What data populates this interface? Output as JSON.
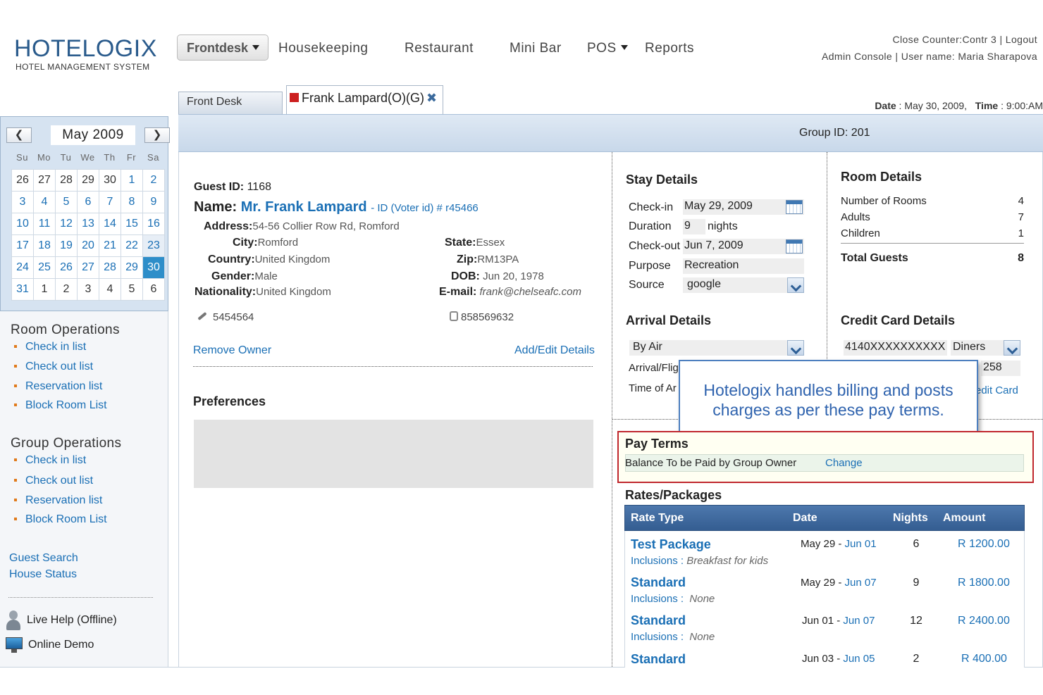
{
  "brand": {
    "name": "HOTELOGIX",
    "tagline": "HOTEL MANAGEMENT SYSTEM"
  },
  "nav": {
    "active": "Frontdesk",
    "items": [
      "Housekeeping",
      "Restaurant",
      "Mini Bar",
      "POS",
      "Reports"
    ]
  },
  "top_links": {
    "line1": "Close Counter:Contr 3 | Logout",
    "line2": "Admin Console | User name: Maria Sharapova"
  },
  "tabs": {
    "front_desk": "Front Desk",
    "guest": "Frank Lampard(O)(G)",
    "close": "✖"
  },
  "datetime": {
    "date_label": "Date",
    "date": "May 30, 2009,",
    "time_label": "Time",
    "time": "9:00:AM"
  },
  "group": {
    "text": "Group ID: 201"
  },
  "calendar": {
    "month": "May 2009",
    "prev": "❮",
    "next": "❯",
    "dow": [
      "Su",
      "Mo",
      "Tu",
      "We",
      "Th",
      "Fr",
      "Sa"
    ],
    "weeks": [
      [
        "26",
        "27",
        "28",
        "29",
        "30",
        "1",
        "2"
      ],
      [
        "3",
        "4",
        "5",
        "6",
        "7",
        "8",
        "9"
      ],
      [
        "10",
        "11",
        "12",
        "13",
        "14",
        "15",
        "16"
      ],
      [
        "17",
        "18",
        "19",
        "20",
        "21",
        "22",
        "23"
      ],
      [
        "24",
        "25",
        "26",
        "27",
        "28",
        "29",
        "30"
      ],
      [
        "31",
        "1",
        "2",
        "3",
        "4",
        "5",
        "6"
      ]
    ]
  },
  "sidebar": {
    "room_ops": {
      "title": "Room Operations",
      "items": [
        "Check in list",
        "Check out list",
        "Reservation list",
        "Block Room List"
      ]
    },
    "group_ops": {
      "title": "Group Operations",
      "items": [
        "Check in list",
        "Check out list",
        "Reservation list",
        "Block Room List"
      ]
    },
    "links": [
      "Guest Search",
      "House Status"
    ],
    "live_help": "Live Help (Offline)",
    "online_demo": "Online Demo"
  },
  "guest": {
    "id_label": "Guest ID:",
    "id": "1168",
    "name_label": "Name:",
    "name": "Mr. Frank Lampard",
    "voter": "- ID (Voter id) # r45466",
    "address_label": "Address:",
    "address": "54-56 Collier Row Rd, Romford",
    "city_label": "City:",
    "city": "Romford",
    "country_label": "Country:",
    "country": "United Kingdom",
    "gender_label": "Gender:",
    "gender": "Male",
    "nationality_label": "Nationality:",
    "nationality": "United Kingdom",
    "state_label": "State:",
    "state": "Essex",
    "zip_label": "Zip:",
    "zip": "RM13PA",
    "dob_label": "DOB:",
    "dob": "Jun 20, 1978",
    "email_label": "E-mail:",
    "email": "frank@chelseafc.com",
    "phone": "5454564",
    "mobile": "858569632",
    "remove_owner": "Remove Owner",
    "add_edit": "Add/Edit Details",
    "preferences": "Preferences"
  },
  "stay": {
    "title": "Stay Details",
    "checkin_label": "Check-in",
    "checkin": "May 29, 2009",
    "duration_label": "Duration",
    "duration": "9",
    "nights_label": "nights",
    "checkout_label": "Check-out",
    "checkout": "Jun 7, 2009",
    "purpose_label": "Purpose",
    "purpose": "Recreation",
    "source_label": "Source",
    "source": "google"
  },
  "arrival": {
    "title": "Arrival Details",
    "mode": "By Air",
    "flight_label": "Arrival/Flig",
    "time_label": "Time of Ar"
  },
  "room": {
    "title": "Room Details",
    "rooms_label": "Number of Rooms",
    "rooms": "4",
    "adults_label": "Adults",
    "adults": "7",
    "children_label": "Children",
    "children": "1",
    "total_label": "Total Guests",
    "total": "8"
  },
  "credit_card": {
    "title": "Credit Card Details",
    "number": "4140XXXXXXXXXX",
    "type": "Diners",
    "cvv": "258",
    "edit": "edit Card"
  },
  "tooltip": {
    "line1": "Hotelogix handles billing and posts",
    "line2": "charges as per these pay terms."
  },
  "pay_terms": {
    "title": "Pay Terms",
    "text": "Balance To be Paid by Group Owner",
    "change": "Change"
  },
  "rates": {
    "title": "Rates/Packages",
    "headers": {
      "type": "Rate Type",
      "date": "Date",
      "nights": "Nights",
      "amount": "Amount"
    },
    "rows": [
      {
        "name": "Test Package",
        "inc_label": "Inclusions :",
        "inc": "Breakfast for kids",
        "from": "May 29 - ",
        "to": "Jun 01",
        "nights": "6",
        "amount": "R 1200.00"
      },
      {
        "name": "Standard",
        "inc_label": "Inclusions :",
        "inc": "None",
        "from": "May 29 - ",
        "to": "Jun 07",
        "nights": "9",
        "amount": "R 1800.00"
      },
      {
        "name": "Standard",
        "inc_label": "Inclusions :",
        "inc": "None",
        "from": "Jun 01 - ",
        "to": "Jun 07",
        "nights": "12",
        "amount": "R 2400.00"
      },
      {
        "name": "Standard",
        "inc_label": "",
        "inc": "",
        "from": "Jun 03 - ",
        "to": "Jun 05",
        "nights": "2",
        "amount": "R 400.00"
      }
    ]
  }
}
